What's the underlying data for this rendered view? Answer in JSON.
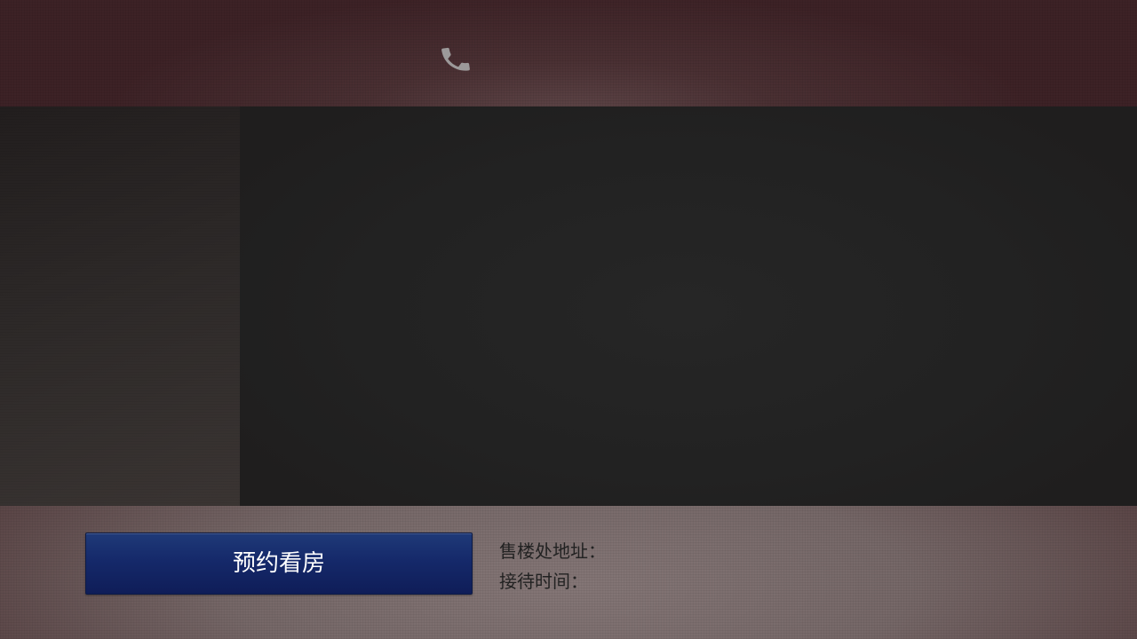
{
  "header": {
    "icon": "phone-icon"
  },
  "footer": {
    "book_button_label": "预约看房",
    "address_label": "售楼处地址：",
    "hours_label": "接待时间："
  },
  "colors": {
    "header_bg": "#4a3033",
    "footer_bg": "#7a6c6c",
    "main_bg": "#232323",
    "button_bg": "#15296a",
    "info_text": "#222222"
  }
}
